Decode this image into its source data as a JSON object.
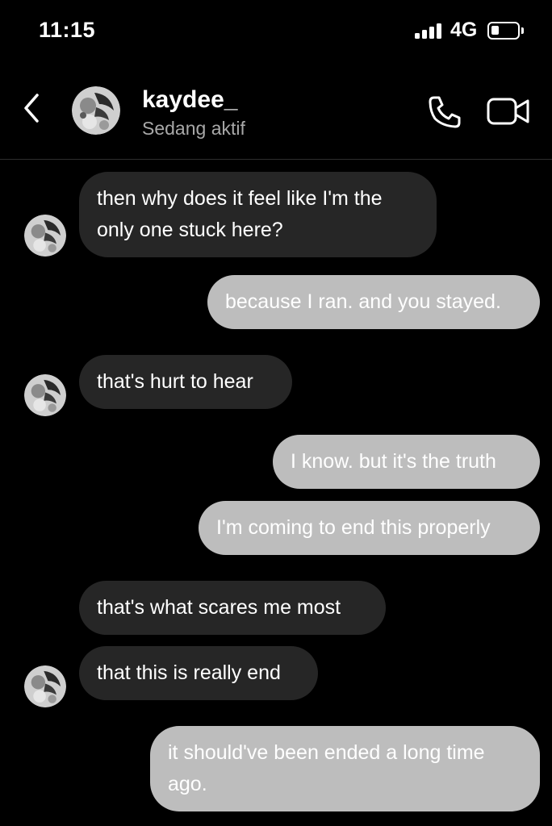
{
  "status_bar": {
    "time": "11:15",
    "network": "4G",
    "battery_level": 0.3
  },
  "header": {
    "contact_name": "kaydee_",
    "contact_status": "Sedang aktif",
    "icons": {
      "back": "chevron-left-icon",
      "call": "phone-icon",
      "video": "video-camera-icon"
    }
  },
  "messages": [
    {
      "from": "them",
      "text": "then why does it feel like I'm the only one stuck here?",
      "line1": "then why does it feel like I'm the",
      "line2": "only one stuck here?"
    },
    {
      "from": "me",
      "text": "because I ran. and you stayed."
    },
    {
      "from": "them",
      "text": "that's hurt to hear"
    },
    {
      "from": "me",
      "text": "I know. but it's the truth"
    },
    {
      "from": "me",
      "text": "I'm coming to end this properly"
    },
    {
      "from": "them",
      "text": "that's what scares me most"
    },
    {
      "from": "them",
      "text": "that this is really end"
    },
    {
      "from": "me",
      "text": "it should've been ended a long time ago.",
      "line1": "it should've been ended a long time",
      "line2": "ago."
    }
  ],
  "colors": {
    "background": "#000000",
    "incoming_bubble": "#262626",
    "outgoing_bubble": "#bdbdbd",
    "secondary_text": "#a8a8a8"
  }
}
